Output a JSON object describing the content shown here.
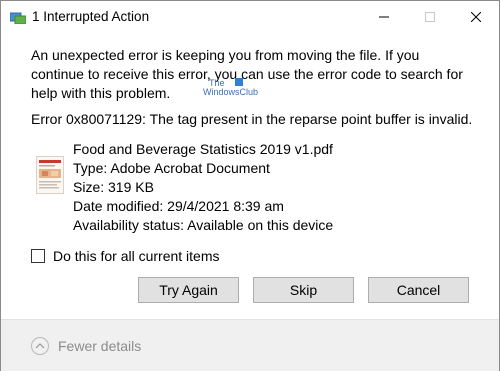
{
  "window": {
    "title": "1 Interrupted Action"
  },
  "message": "An unexpected error is keeping you from moving the file. If you continue to receive this error, you can use the error code to search for help with this problem.",
  "error_line": "Error 0x80071129: The tag present in the reparse point buffer is invalid.",
  "watermark": {
    "line1": "The",
    "line2": "WindowsClub"
  },
  "file": {
    "name": "Food and Beverage Statistics 2019 v1.pdf",
    "type": "Type: Adobe Acrobat Document",
    "size": "Size: 319 KB",
    "modified": "Date modified: 29/4/2021 8:39 am",
    "availability": "Availability status: Available on this device"
  },
  "checkbox": {
    "label": "Do this for all current items",
    "checked": false
  },
  "buttons": {
    "try_again": "Try Again",
    "skip": "Skip",
    "cancel": "Cancel"
  },
  "footer": {
    "fewer_details": "Fewer details"
  }
}
